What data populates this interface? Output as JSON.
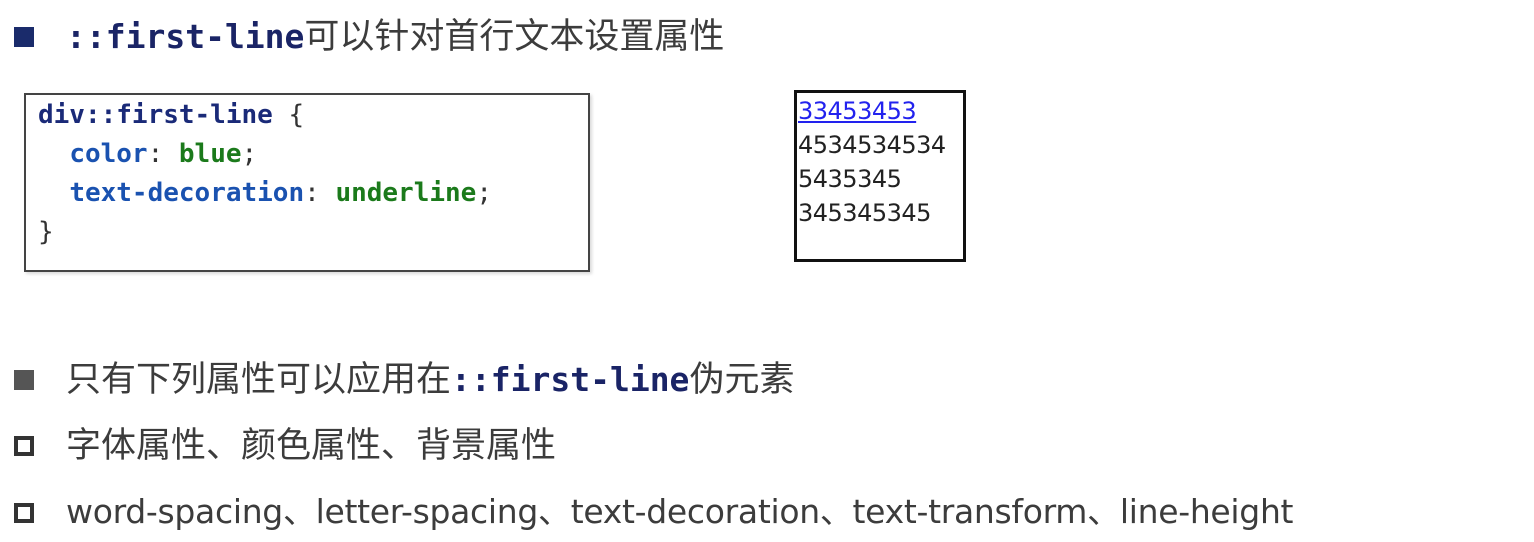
{
  "heading": {
    "code_text": "::first-line",
    "text": "可以针对首行文本设置属性"
  },
  "code_example": {
    "line1_selector": "div::first-line",
    "line1_brace": " {",
    "line2_prop": "color",
    "line2_colon": ": ",
    "line2_value": "blue",
    "line2_semi": ";",
    "line3_prop": "text-decoration",
    "line3_colon": ": ",
    "line3_value": "underline",
    "line3_semi": ";",
    "line4_brace": "}"
  },
  "demo": {
    "lines": [
      "33453453",
      "4534534534",
      "5435345",
      "345345345"
    ]
  },
  "bullets": {
    "intro_prefix": "只有下列属性可以应用在",
    "intro_code": "::first-line",
    "intro_suffix": "伪元素",
    "item1": "字体属性、颜色属性、背景属性",
    "item2": "word-spacing、letter-spacing、text-decoration、text-transform、line-height"
  },
  "colors": {
    "code_keyword": "#1a2466",
    "css_property": "#1a52b0",
    "css_value": "#1b7a1b",
    "demo_first_line": "#2222ee"
  }
}
